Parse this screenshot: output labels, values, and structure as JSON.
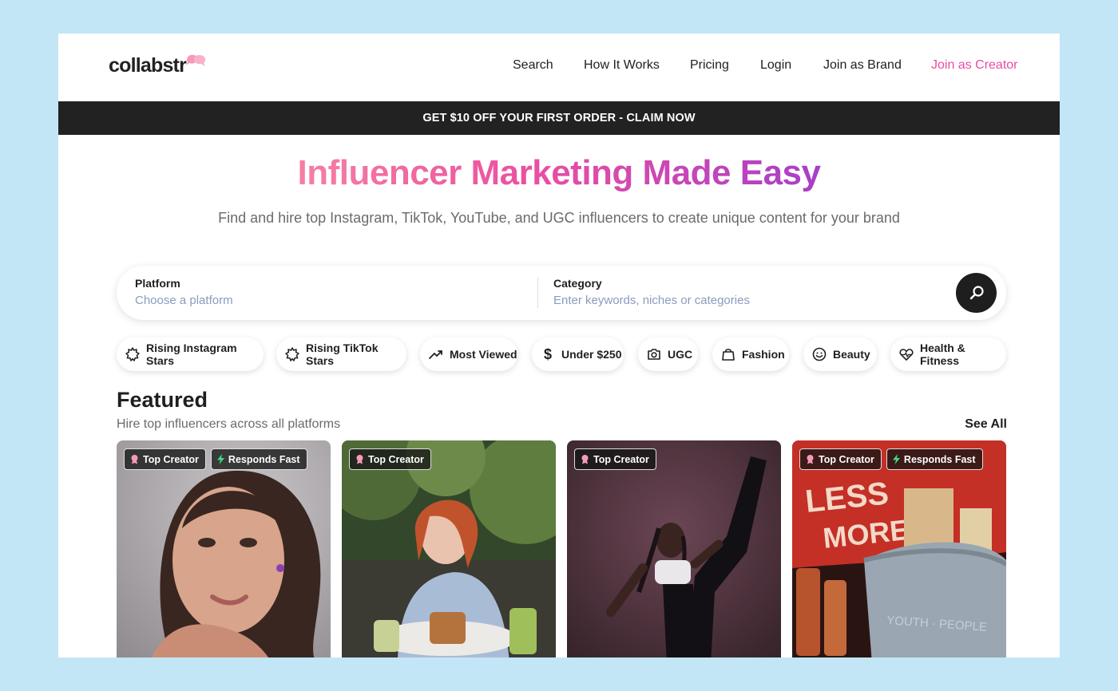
{
  "header": {
    "logo_text": "collabstr",
    "nav": [
      {
        "label": "Search"
      },
      {
        "label": "How It Works"
      },
      {
        "label": "Pricing"
      },
      {
        "label": "Login"
      },
      {
        "label": "Join as Brand"
      },
      {
        "label": "Join as Creator"
      }
    ]
  },
  "promo": {
    "text": "GET $10 OFF YOUR FIRST ORDER - CLAIM NOW"
  },
  "hero": {
    "title": "Influencer Marketing Made Easy",
    "subtitle": "Find and hire top Instagram, TikTok, YouTube, and UGC influencers to create unique content for your brand"
  },
  "search": {
    "platform_label": "Platform",
    "platform_placeholder": "Choose a platform",
    "category_label": "Category",
    "category_placeholder": "Enter keywords, niches or categories",
    "button_icon": "search-icon"
  },
  "chips": [
    {
      "label": "Rising Instagram Stars",
      "icon": "sparkle-badge-icon"
    },
    {
      "label": "Rising TikTok Stars",
      "icon": "sparkle-badge-icon"
    },
    {
      "label": "Most Viewed",
      "icon": "trending-up-icon"
    },
    {
      "label": "Under $250",
      "icon": "dollar-icon"
    },
    {
      "label": "UGC",
      "icon": "camera-icon"
    },
    {
      "label": "Fashion",
      "icon": "shopping-bag-icon"
    },
    {
      "label": "Beauty",
      "icon": "smiley-icon"
    },
    {
      "label": "Health & Fitness",
      "icon": "heart-pulse-icon"
    }
  ],
  "featured": {
    "title": "Featured",
    "subtitle": "Hire top influencers across all platforms",
    "see_all": "See All",
    "cards": [
      {
        "badges": [
          "Top Creator",
          "Responds Fast"
        ]
      },
      {
        "badges": [
          "Top Creator"
        ]
      },
      {
        "badges": [
          "Top Creator"
        ]
      },
      {
        "badges": [
          "Top Creator",
          "Responds Fast"
        ]
      }
    ]
  },
  "colors": {
    "accent_pink": "#ec4aa0",
    "gradient_start": "#f77fa3",
    "gradient_end": "#a83ec9",
    "promo_bg": "#222222",
    "page_bg": "#c2e6f5",
    "placeholder": "#8b9bbe",
    "fast_bolt": "#3ddc84"
  }
}
